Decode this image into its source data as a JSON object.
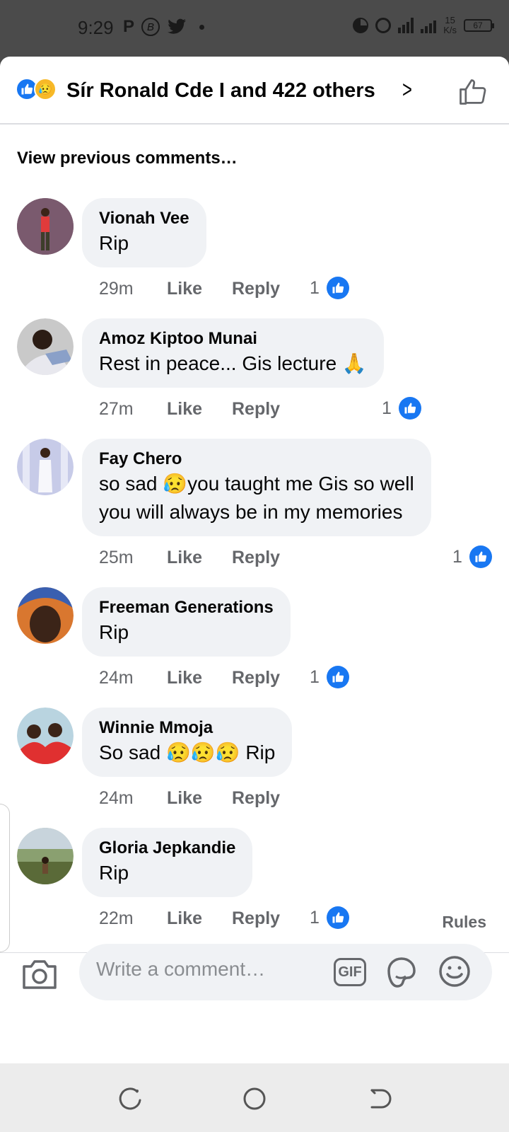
{
  "status_bar": {
    "time": "9:29",
    "left_icons": [
      "parking-icon",
      "bitcoin-icon",
      "twitter-icon",
      "dot-icon"
    ],
    "net_speed_value": "15",
    "net_speed_unit": "K/s",
    "battery": "67"
  },
  "header": {
    "reactions": [
      "like-reaction-icon",
      "sad-reaction-icon"
    ],
    "title": "Sír Ronald Cde I and 422 others"
  },
  "view_previous": "View previous comments…",
  "comments": [
    {
      "name": "Vionah Vee",
      "text": [
        "Rip"
      ],
      "time": "29m",
      "like": "Like",
      "reply": "Reply",
      "likes": "1"
    },
    {
      "name": "Amoz Kiptoo Munai",
      "text": [
        "Rest in peace... Gis lecture 🙏"
      ],
      "time": "27m",
      "like": "Like",
      "reply": "Reply",
      "likes": "1"
    },
    {
      "name": "Fay Chero",
      "text": [
        "so sad 😥you taught me Gis so well",
        "you will always be in my memories"
      ],
      "time": "25m",
      "like": "Like",
      "reply": "Reply",
      "likes": "1"
    },
    {
      "name": "Freeman Generations",
      "text": [
        "Rip"
      ],
      "time": "24m",
      "like": "Like",
      "reply": "Reply",
      "likes": "1"
    },
    {
      "name": "Winnie Mmoja",
      "text": [
        "So sad 😥😥😥 Rip"
      ],
      "time": "24m",
      "like": "Like",
      "reply": "Reply",
      "likes": ""
    },
    {
      "name": "Gloria Jepkandie",
      "text": [
        "Rip"
      ],
      "time": "22m",
      "like": "Like",
      "reply": "Reply",
      "likes": "1"
    }
  ],
  "footer": {
    "rules": "Rules",
    "input_placeholder": "Write a comment…",
    "gif_label": "GIF"
  },
  "colors": {
    "accent": "#1877f2",
    "bubble": "#f0f2f5",
    "secondary_text": "#65676b"
  }
}
